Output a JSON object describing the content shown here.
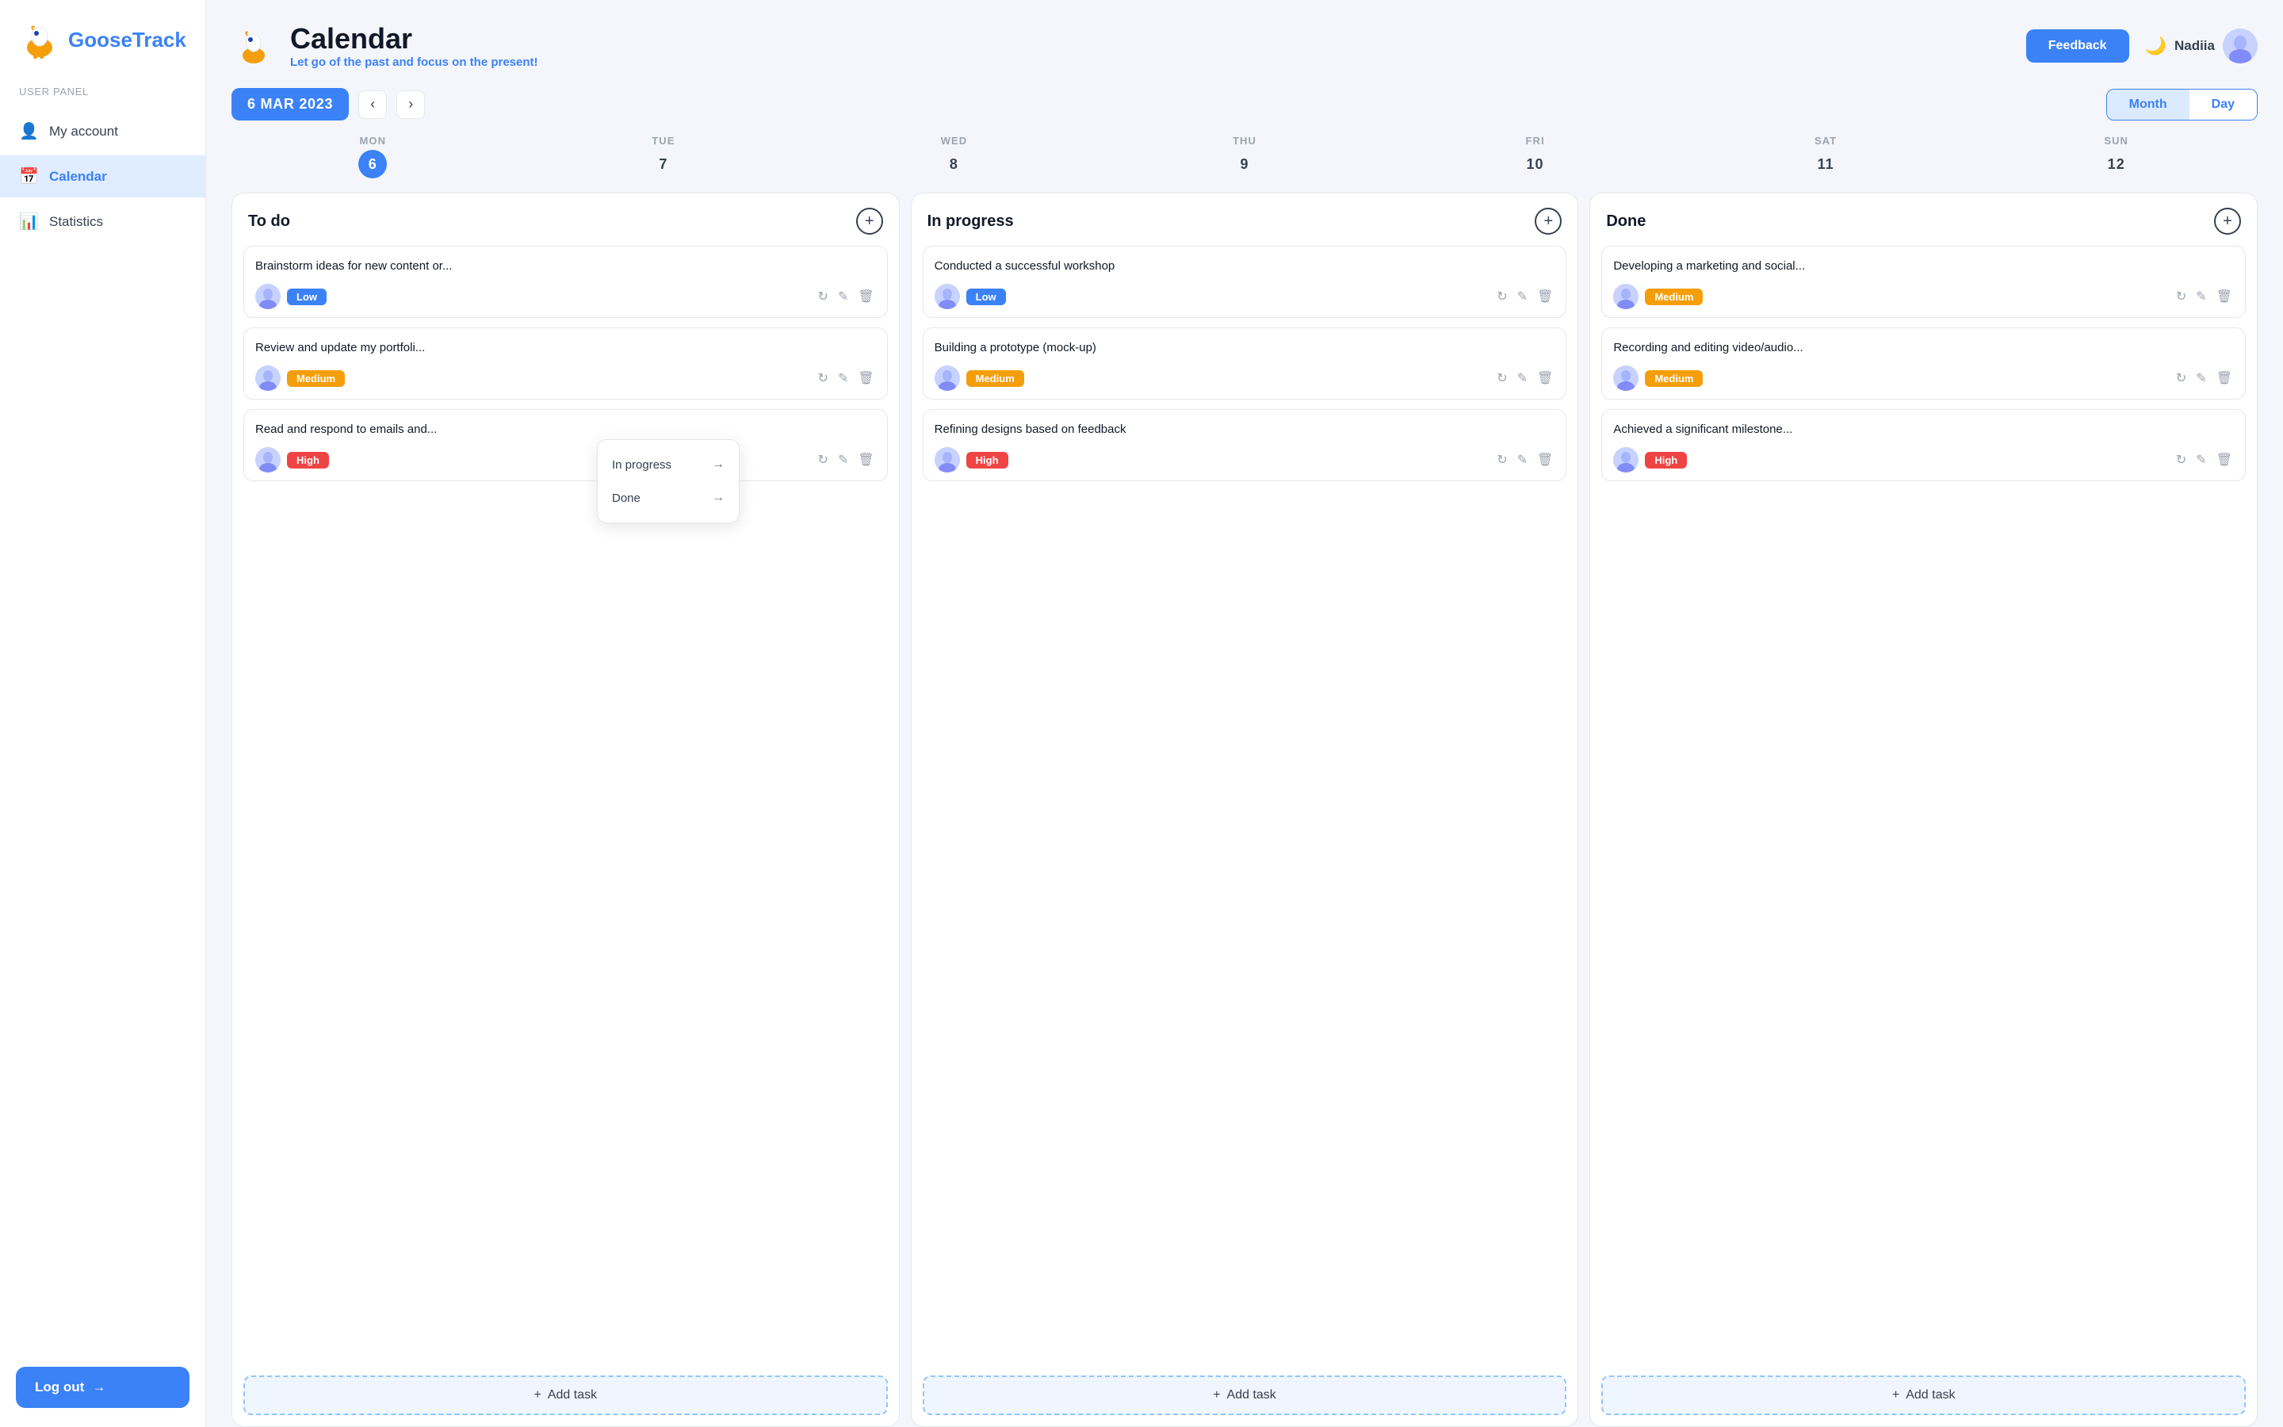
{
  "sidebar": {
    "logo_text": "GooseTrack",
    "user_panel_label": "User Panel",
    "items": [
      {
        "id": "my-account",
        "label": "My account",
        "icon": "👤",
        "active": false
      },
      {
        "id": "calendar",
        "label": "Calendar",
        "icon": "📅",
        "active": true
      },
      {
        "id": "statistics",
        "label": "Statistics",
        "icon": "📊",
        "active": false
      }
    ],
    "logout_label": "Log out"
  },
  "header": {
    "title": "Calendar",
    "subtitle_highlight": "Let go",
    "subtitle_rest": " of the past and focus on the present!",
    "feedback_label": "Feedback",
    "user_name": "Nadiia",
    "moon_icon": "🌙"
  },
  "calendar": {
    "date_badge": "6 MAR 2023",
    "view_month": "Month",
    "view_day": "Day",
    "days": [
      {
        "name": "MON",
        "num": "6",
        "today": true
      },
      {
        "name": "TUE",
        "num": "7",
        "today": false
      },
      {
        "name": "WED",
        "num": "8",
        "today": false
      },
      {
        "name": "THU",
        "num": "9",
        "today": false
      },
      {
        "name": "FRI",
        "num": "10",
        "today": false
      },
      {
        "name": "SAT",
        "num": "11",
        "today": false
      },
      {
        "name": "SUN",
        "num": "12",
        "today": false
      }
    ]
  },
  "columns": [
    {
      "id": "todo",
      "title": "To do",
      "tasks": [
        {
          "id": "task1",
          "title": "Brainstorm ideas for new content or...",
          "priority": "Low",
          "priority_class": "priority-low"
        },
        {
          "id": "task2",
          "title": "Review and update my portfoli...",
          "priority": "Medium",
          "priority_class": "priority-medium"
        },
        {
          "id": "task3",
          "title": "Read and respond to emails and...",
          "priority": "High",
          "priority_class": "priority-high"
        }
      ],
      "add_label": "Add task"
    },
    {
      "id": "inprogress",
      "title": "In progress",
      "tasks": [
        {
          "id": "task4",
          "title": "Conducted a successful workshop",
          "priority": "Low",
          "priority_class": "priority-low"
        },
        {
          "id": "task5",
          "title": "Building a prototype (mock-up)",
          "priority": "Medium",
          "priority_class": "priority-medium"
        },
        {
          "id": "task6",
          "title": "Refining designs based on feedback",
          "priority": "High",
          "priority_class": "priority-high"
        }
      ],
      "add_label": "Add task"
    },
    {
      "id": "done",
      "title": "Done",
      "tasks": [
        {
          "id": "task7",
          "title": "Developing a marketing and social...",
          "priority": "Medium",
          "priority_class": "priority-medium"
        },
        {
          "id": "task8",
          "title": "Recording and editing video/audio...",
          "priority": "Medium",
          "priority_class": "priority-medium"
        },
        {
          "id": "task9",
          "title": "Achieved a significant milestone...",
          "priority": "High",
          "priority_class": "priority-high"
        }
      ],
      "add_label": "Add task"
    }
  ],
  "dropdown": {
    "items": [
      {
        "id": "in-progress",
        "label": "In progress"
      },
      {
        "id": "done",
        "label": "Done"
      }
    ]
  }
}
